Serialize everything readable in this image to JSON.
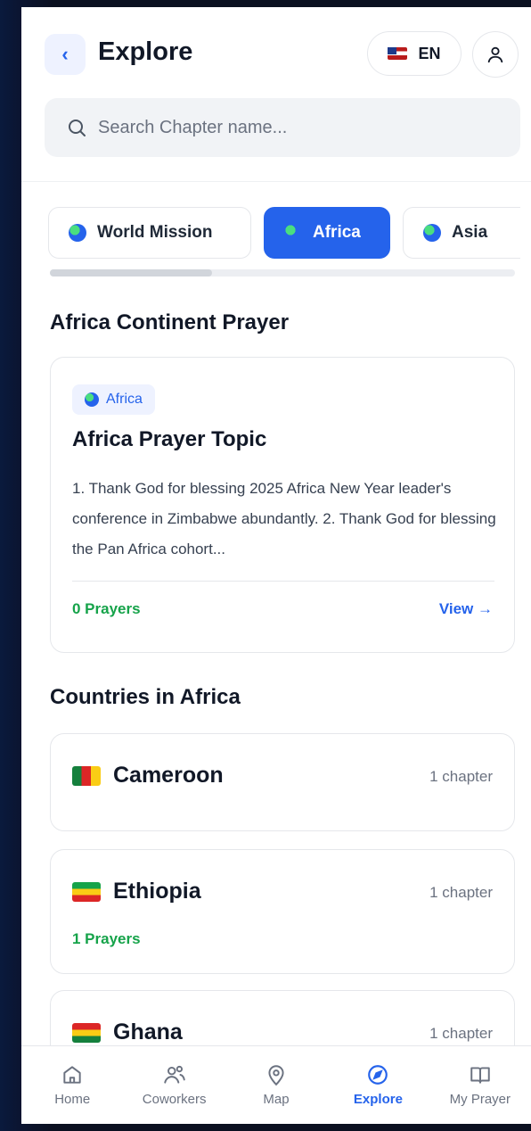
{
  "header": {
    "title": "Explore",
    "back_label": "‹",
    "lang_label": "EN",
    "search_placeholder": "Search Chapter name..."
  },
  "tabs": [
    {
      "label": "World Mission",
      "active": false
    },
    {
      "label": "Africa",
      "active": true
    },
    {
      "label": "Asia",
      "active": false
    }
  ],
  "continent_section": {
    "title": "Africa Continent Prayer",
    "card": {
      "badge": "Africa",
      "title": "Africa Prayer Topic",
      "description": "1. Thank God for blessing 2025 Africa New Year leader's conference in Zimbabwe abundantly. 2. Thank God for blessing the Pan Africa cohort...",
      "prayers": "0 Prayers",
      "view_label": "View →"
    }
  },
  "countries_section": {
    "title": "Countries in Africa",
    "countries": [
      {
        "name": "Cameroon",
        "chapters": "1 chapter",
        "prayers": "",
        "flag": "cameroon-flag"
      },
      {
        "name": "Ethiopia",
        "chapters": "1 chapter",
        "prayers": "1 Prayers",
        "flag": "ethiopia-flag"
      },
      {
        "name": "Ghana",
        "chapters": "1 chapter",
        "prayers": "",
        "flag": "ghana-flag"
      }
    ]
  },
  "bottom_nav": [
    {
      "label": "Home",
      "icon": "home-icon",
      "active": false
    },
    {
      "label": "Coworkers",
      "icon": "users-icon",
      "active": false
    },
    {
      "label": "Map",
      "icon": "map-pin-icon",
      "active": false
    },
    {
      "label": "Explore",
      "icon": "compass-icon",
      "active": true
    },
    {
      "label": "My Prayer",
      "icon": "book-icon",
      "active": false
    }
  ],
  "colors": {
    "accent": "#2563eb",
    "success": "#16a34a",
    "background": "#0b1020"
  }
}
